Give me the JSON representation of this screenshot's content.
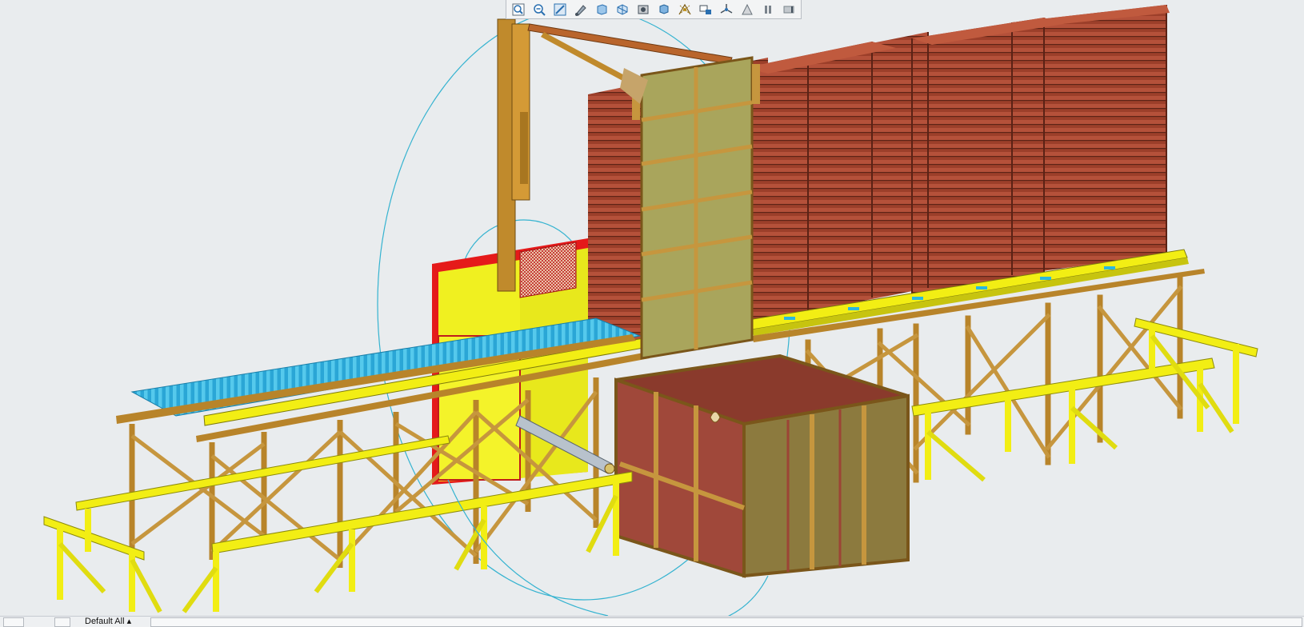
{
  "toolbar": {
    "buttons": [
      {
        "name": "zoom-window-icon"
      },
      {
        "name": "zoom-out-icon"
      },
      {
        "name": "refit-icon"
      },
      {
        "name": "repaint-icon"
      },
      {
        "name": "display-style-icon"
      },
      {
        "name": "saved-views-icon"
      },
      {
        "name": "view-manager-icon"
      },
      {
        "name": "named-view-icon"
      },
      {
        "name": "datum-display-icon"
      },
      {
        "name": "annotation-display-icon"
      },
      {
        "name": "spin-center-icon"
      },
      {
        "name": "appearance-icon"
      },
      {
        "name": "pause-icon"
      },
      {
        "name": "next-icon"
      }
    ]
  },
  "status": {
    "view_tab": "Default All ▴"
  },
  "colors": {
    "background": "#e9ecee",
    "structure": "#b8842a",
    "structure_dark": "#7a561a",
    "rail": "#f2ee14",
    "conveyor": "#2ab8e0",
    "pallet": "#a8442c",
    "pallet_dark": "#6e2c1c",
    "door": "#a9a55c",
    "cabinet": "#f0f020",
    "cabinet_frame": "#e51a1a",
    "bin": "#a0483a",
    "spin_circle": "#35b3d0"
  }
}
